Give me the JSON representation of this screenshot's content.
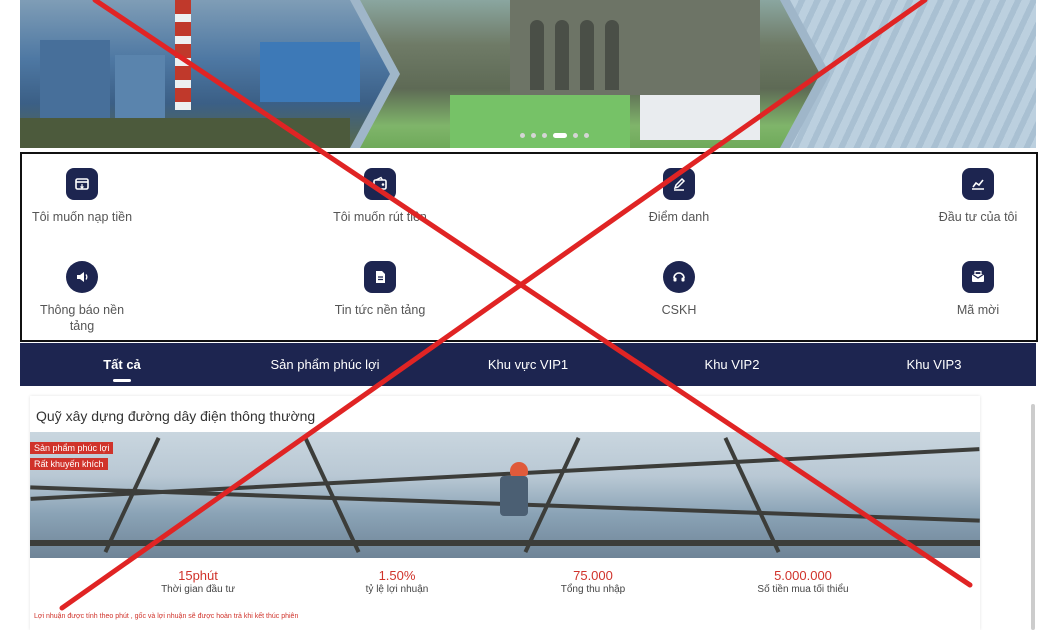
{
  "banner": {
    "slide_count": 6,
    "active_slide": 4
  },
  "quick_menu": {
    "items": [
      {
        "label": "Tôi muốn nạp tiền",
        "icon": "wallet-icon"
      },
      {
        "label": "Tôi muốn rút tiền",
        "icon": "withdraw-wallet-icon"
      },
      {
        "label": "Điểm danh",
        "icon": "pen-checkin-icon"
      },
      {
        "label": "Đầu tư của tôi",
        "icon": "chart-icon"
      },
      {
        "label": "Thông báo nền tảng",
        "icon": "speaker-icon"
      },
      {
        "label": "Tin tức nền tảng",
        "icon": "document-icon"
      },
      {
        "label": "CSKH",
        "icon": "headset-icon"
      },
      {
        "label": "Mã mời",
        "icon": "envelope-icon"
      }
    ]
  },
  "tabs": [
    {
      "label": "Tất cả",
      "active": true
    },
    {
      "label": "Sản phẩm phúc lợi",
      "active": false
    },
    {
      "label": "Khu vực VIP1",
      "active": false
    },
    {
      "label": "Khu VIP2",
      "active": false
    },
    {
      "label": "Khu VIP3",
      "active": false
    }
  ],
  "product": {
    "title": "Quỹ xây dựng đường dây điện thông thường",
    "tags": [
      "Sản phẩm phúc lợi",
      "Rất khuyến khích"
    ],
    "stats": [
      {
        "value": "15phút",
        "label": "Thời gian đầu tư"
      },
      {
        "value": "1.50%",
        "label": "tỷ lệ lợi nhuận"
      },
      {
        "value": "75.000",
        "label": "Tổng thu nhập"
      },
      {
        "value": "5.000.000",
        "label": "Số tiền mua tối thiểu"
      }
    ],
    "note": "Lợi nhuận được tính theo phút , gốc và lợi nhuận sẽ được hoàn trả khi kết thúc phiên"
  },
  "colors": {
    "navy": "#1d2550",
    "accent_red": "#d0332b",
    "cross_red": "#e02424"
  }
}
